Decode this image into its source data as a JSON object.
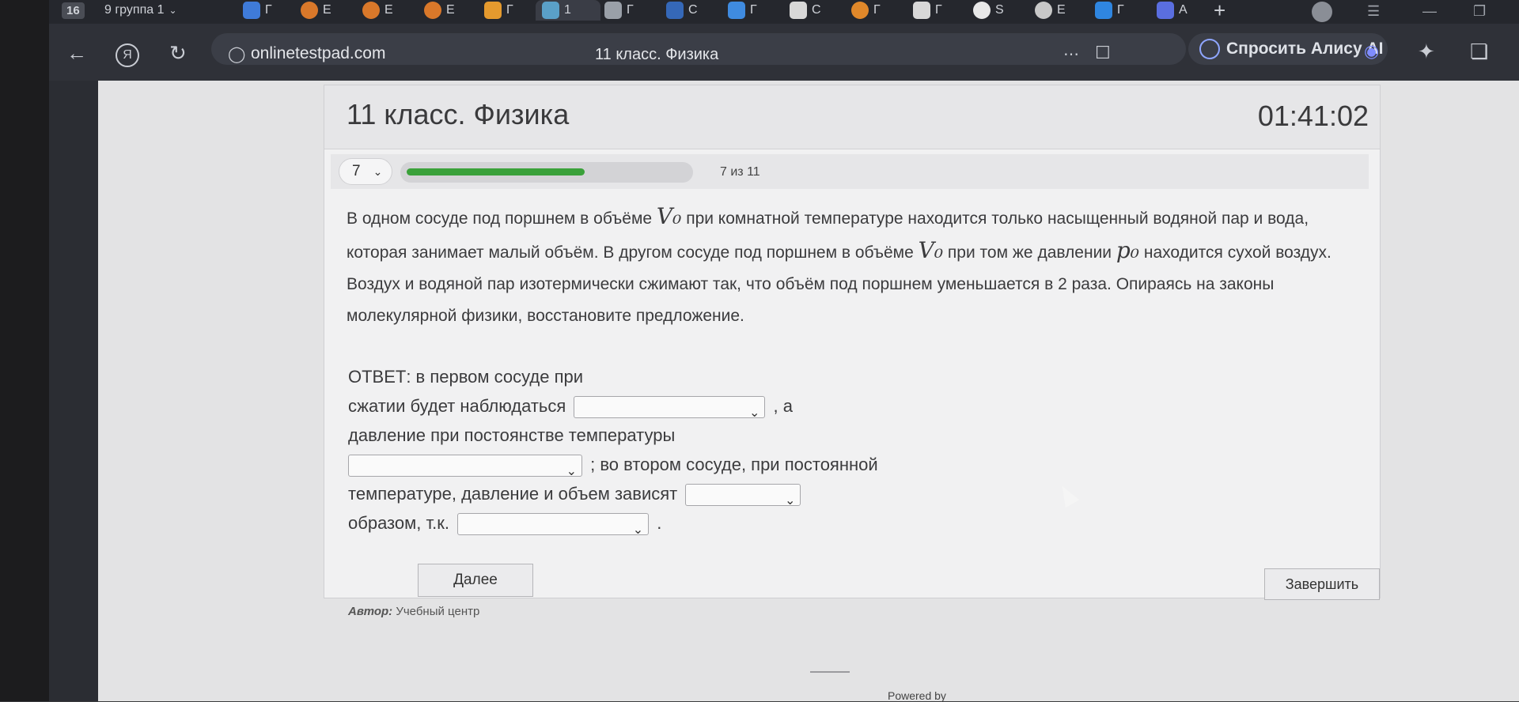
{
  "browser": {
    "tab_count_badge": "16",
    "tab_group_label": "9 группа 1",
    "tab_labels": [
      "Г",
      "Е",
      "Е",
      "Е",
      "Г",
      "1",
      "Г",
      "С",
      "Г",
      "С",
      "Г",
      "Г",
      "Ѕ",
      "Е",
      "Г",
      "А"
    ],
    "url": "onlinetestpad.com",
    "page_title": "11 класс. Физика",
    "alice_label": "Спросить Алису AI"
  },
  "test": {
    "title": "11 класс. Физика",
    "timer": "01:41:02",
    "question_number": "7",
    "progress_text": "7 из 11",
    "progress_fraction": 0.636,
    "question_parts": {
      "p1": "В одном сосуде под поршнем в объёме ",
      "v0": "V₀",
      "p2": " при комнатной температуре находится только насыщенный водяной пар и вода, которая занимает малый объём. В другом сосуде под поршнем в объёме ",
      "p3": " при том же давлении ",
      "p0": "p₀",
      "p4": " находится сухой воздух. Воздух и водяной пар изотермически сжимают так, что объём под поршнем уменьшается в 2 раза.  Опираясь на законы молекулярной физики, восстановите предложение."
    },
    "answer": {
      "line1": "ОТВЕТ: в первом сосуде при",
      "line2": "сжатии будет наблюдаться",
      "line2_suffix": ", а",
      "line3": "давление при постоянстве температуры",
      "line4_suffix": "; во втором сосуде, при постоянной",
      "line5": "температуре, давление и объем зависят",
      "line6": "образом, т.к.",
      "line6_suffix": "."
    },
    "next_button": "Далее",
    "finish_button": "Завершить",
    "author_label": "Автор:",
    "author_value": "Учебный центр",
    "powered_by": "Powered by"
  }
}
